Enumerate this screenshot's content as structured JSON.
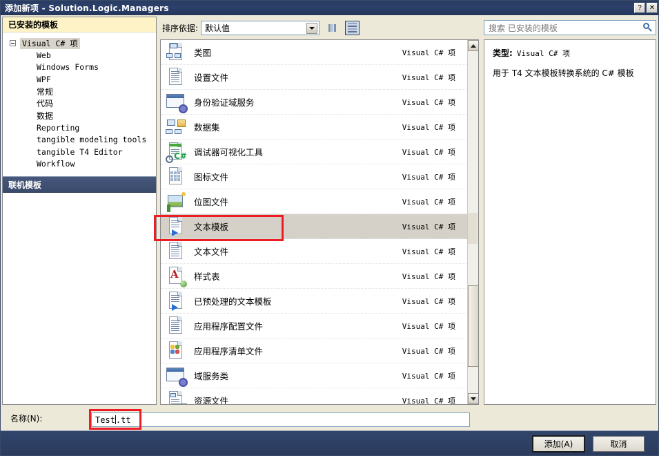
{
  "window": {
    "title": "添加新项 - Solution.Logic.Managers",
    "help_button": "?",
    "close_button": "✕"
  },
  "left_panel": {
    "header": "已安装的模板",
    "tree_root": "Visual C# 项",
    "tree_children": [
      "Web",
      "Windows Forms",
      "WPF",
      "常规",
      "代码",
      "数据",
      "Reporting",
      "tangible modeling tools",
      "tangible T4 Editor",
      "Workflow"
    ],
    "online_templates": "联机模板"
  },
  "toolbar": {
    "sort_label": "排序依据:",
    "sort_value": "默认值",
    "view_icons_name": "small-icons-view",
    "view_list_name": "list-view"
  },
  "search": {
    "placeholder": "搜索 已安装的模板",
    "value": ""
  },
  "info_panel": {
    "type_label": "类型:",
    "type_value": "Visual C# 项",
    "description": "用于 T4 文本模板转换系统的 C# 模板"
  },
  "templates": [
    {
      "name": "类图",
      "kind": "Visual C# 项",
      "icon": "class-diagram-icon",
      "selected": false
    },
    {
      "name": "设置文件",
      "kind": "Visual C# 项",
      "icon": "settings-file-icon",
      "selected": false
    },
    {
      "name": "身份验证域服务",
      "kind": "Visual C# 项",
      "icon": "auth-domain-service-icon",
      "selected": false
    },
    {
      "name": "数据集",
      "kind": "Visual C# 项",
      "icon": "dataset-icon",
      "selected": false
    },
    {
      "name": "调试器可视化工具",
      "kind": "Visual C# 项",
      "icon": "debugger-visualizer-icon",
      "selected": false
    },
    {
      "name": "图标文件",
      "kind": "Visual C# 项",
      "icon": "icon-file-icon",
      "selected": false
    },
    {
      "name": "位图文件",
      "kind": "Visual C# 项",
      "icon": "bitmap-file-icon",
      "selected": false
    },
    {
      "name": "文本模板",
      "kind": "Visual C# 项",
      "icon": "text-template-icon",
      "selected": true
    },
    {
      "name": "文本文件",
      "kind": "Visual C# 项",
      "icon": "text-file-icon",
      "selected": false
    },
    {
      "name": "样式表",
      "kind": "Visual C# 项",
      "icon": "stylesheet-icon",
      "selected": false
    },
    {
      "name": "已预处理的文本模板",
      "kind": "Visual C# 项",
      "icon": "preprocessed-template-icon",
      "selected": false
    },
    {
      "name": "应用程序配置文件",
      "kind": "Visual C# 项",
      "icon": "app-config-icon",
      "selected": false
    },
    {
      "name": "应用程序清单文件",
      "kind": "Visual C# 项",
      "icon": "app-manifest-icon",
      "selected": false
    },
    {
      "name": "域服务类",
      "kind": "Visual C# 项",
      "icon": "domain-service-class-icon",
      "selected": false
    },
    {
      "name": "资源文件",
      "kind": "Visual C# 项",
      "icon": "resource-file-icon",
      "selected": false
    }
  ],
  "name_field": {
    "label": "名称(N):",
    "value_before_caret": "Test",
    "value_after_caret": ".tt"
  },
  "footer": {
    "add_label": "添加(A)",
    "cancel_label": "取消"
  },
  "colors": {
    "titlebar": "#2c406b",
    "footer": "#31456b",
    "online_band": "#47587c",
    "installed_header": "#fdf3c6",
    "selection": "#d5d1c8",
    "annotation_red": "#ee1c25",
    "dialog_face": "#ece9d8"
  }
}
